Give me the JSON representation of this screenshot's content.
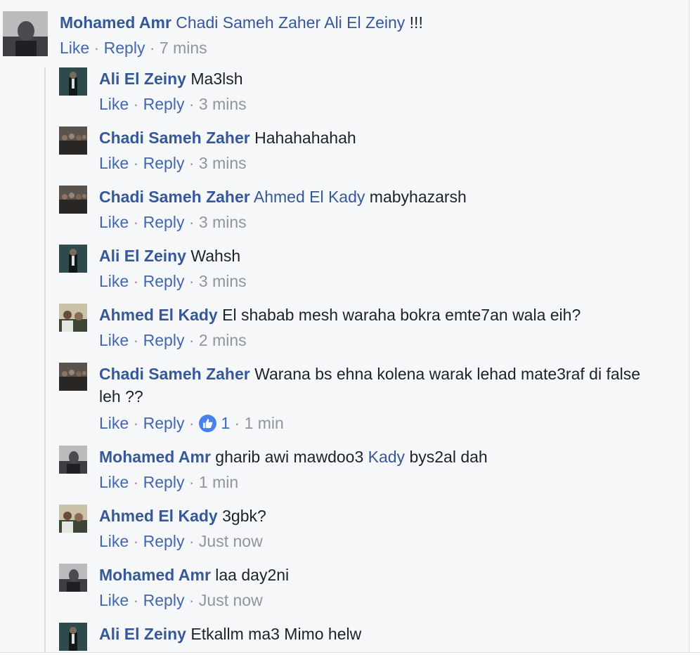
{
  "top_comment": {
    "author": "Mohamed Amr",
    "mention": "Chadi Sameh Zaher Ali El Zeiny",
    "text": " !!!",
    "like": "Like",
    "reply": "Reply",
    "time": "7 mins"
  },
  "replies": [
    {
      "author": "Ali El Zeiny",
      "text": "Ma3lsh",
      "like": "Like",
      "reply": "Reply",
      "time": "3 mins"
    },
    {
      "author": "Chadi Sameh Zaher",
      "text": "Hahahahahah",
      "like": "Like",
      "reply": "Reply",
      "time": "3 mins"
    },
    {
      "author": "Chadi Sameh Zaher",
      "mention": "Ahmed El Kady",
      "text": "mabyhazarsh",
      "like": "Like",
      "reply": "Reply",
      "time": "3 mins"
    },
    {
      "author": "Ali El Zeiny",
      "text": "Wahsh",
      "like": "Like",
      "reply": "Reply",
      "time": "3 mins"
    },
    {
      "author": "Ahmed El Kady",
      "text": "El shabab mesh waraha bokra emte7an wala eih?",
      "like": "Like",
      "reply": "Reply",
      "time": "2 mins"
    },
    {
      "author": "Chadi Sameh Zaher",
      "text": "Warana bs ehna kolena warak lehad mate3raf di false leh ??",
      "like": "Like",
      "reply": "Reply",
      "reaction_count": "1",
      "time": "1 min"
    },
    {
      "author": "Mohamed Amr",
      "text_before": "gharib awi mawdoo3",
      "mention": "Kady",
      "text_after": "bys2al dah",
      "like": "Like",
      "reply": "Reply",
      "time": "1 min"
    },
    {
      "author": "Ahmed El Kady",
      "text": "3gbk?",
      "like": "Like",
      "reply": "Reply",
      "time": "Just now"
    },
    {
      "author": "Mohamed Amr",
      "text": "laa day2ni",
      "like": "Like",
      "reply": "Reply",
      "time": "Just now"
    },
    {
      "author": "Ali El Zeiny",
      "text": "Etkallm ma3 Mimo helw"
    }
  ],
  "separator": " · ",
  "colors": {
    "link": "#365899",
    "action": "#4267b2",
    "meta": "#90949c",
    "like_icon": "#4a7ff0"
  },
  "icons": {
    "reaction": "thumbs-up-icon"
  }
}
